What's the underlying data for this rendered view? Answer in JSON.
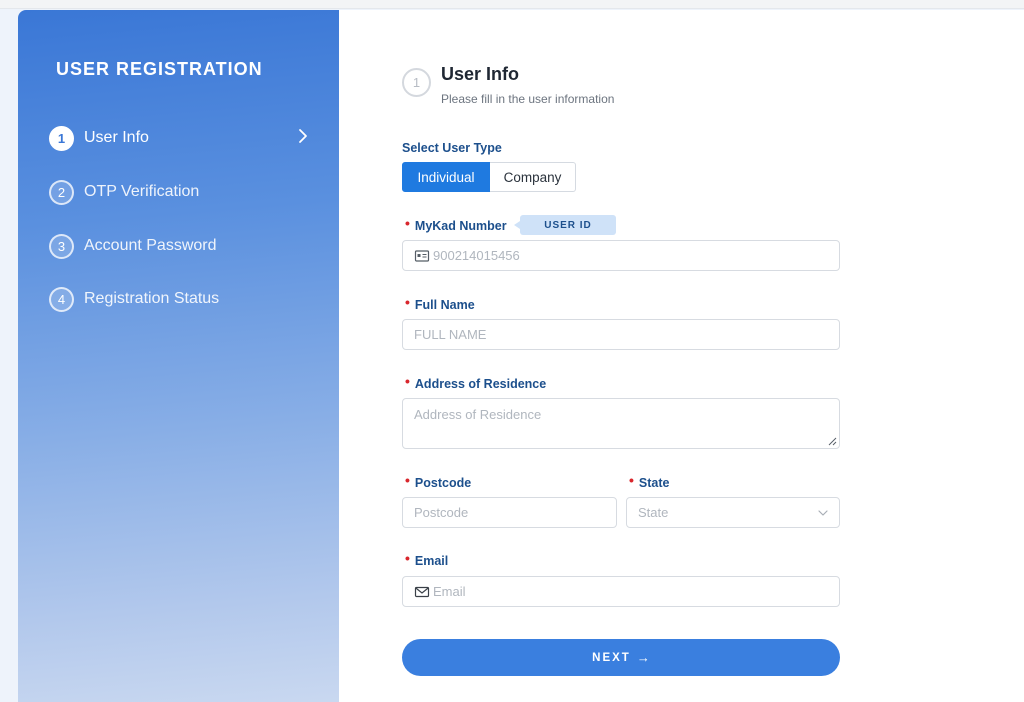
{
  "sidebar": {
    "title": "USER REGISTRATION",
    "steps": [
      {
        "num": "1",
        "label": "User Info"
      },
      {
        "num": "2",
        "label": "OTP Verification"
      },
      {
        "num": "3",
        "label": "Account Password"
      },
      {
        "num": "4",
        "label": "Registration Status"
      }
    ]
  },
  "header": {
    "step_num": "1",
    "title": "User Info",
    "subtitle": "Please fill in the user information"
  },
  "form": {
    "user_type": {
      "label": "Select User Type",
      "options": [
        "Individual",
        "Company"
      ],
      "selected": "Individual"
    },
    "mykad": {
      "label": "MyKad Number",
      "badge": "USER ID",
      "placeholder": "900214015456",
      "value": ""
    },
    "full_name": {
      "label": "Full Name",
      "placeholder": "FULL NAME",
      "value": ""
    },
    "address": {
      "label": "Address of Residence",
      "placeholder": "Address of Residence",
      "value": ""
    },
    "postcode": {
      "label": "Postcode",
      "placeholder": "Postcode",
      "value": ""
    },
    "state": {
      "label": "State",
      "placeholder": "State"
    },
    "email": {
      "label": "Email",
      "placeholder": "Email",
      "value": ""
    },
    "next_label": "NEXT"
  },
  "colors": {
    "primary": "#1f7ae0",
    "button": "#3a7fdf",
    "label": "#1c4f8c",
    "required": "#d9262c"
  }
}
